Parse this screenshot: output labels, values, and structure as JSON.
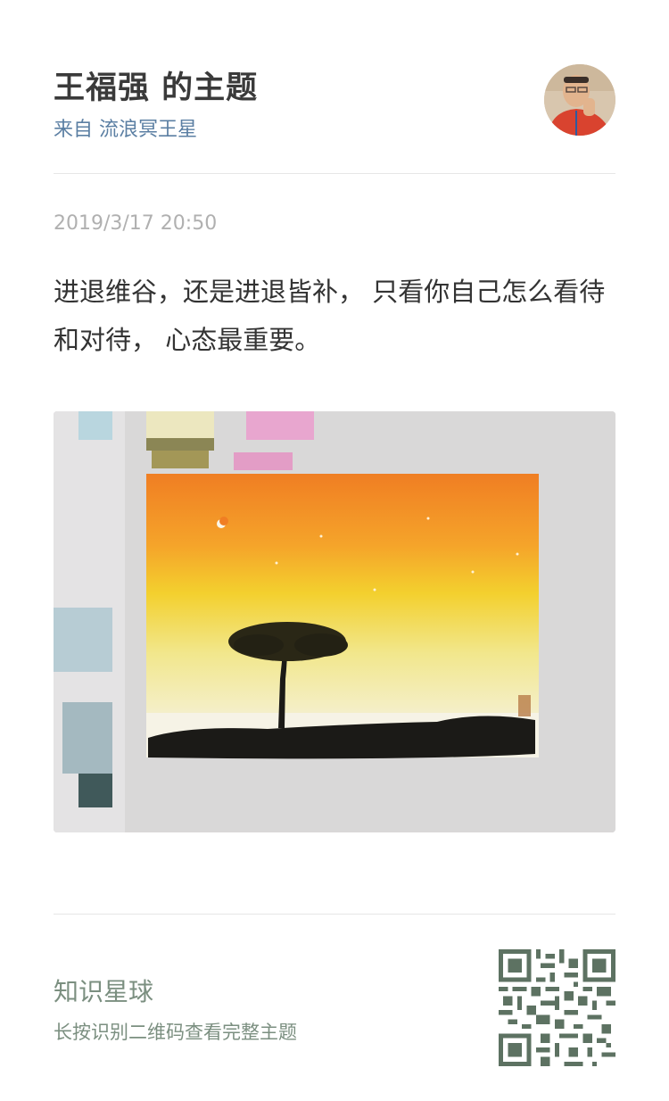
{
  "header": {
    "title": "王福强 的主题",
    "source": "来自 流浪冥王星"
  },
  "post": {
    "timestamp": "2019/3/17 20:50",
    "text": "进退维谷，还是进退皆补， 只看你自己怎么看待和对待， 心态最重要。"
  },
  "footer": {
    "brand": "知识星球",
    "hint": "长按识别二维码查看完整主题"
  },
  "colors": {
    "title": "#3a3a3a",
    "link": "#5b7fa3",
    "muted": "#b0b0b0",
    "brand": "#7b8f80",
    "qr": "#5d7262"
  },
  "icons": {
    "qr": "qr-code-icon"
  }
}
